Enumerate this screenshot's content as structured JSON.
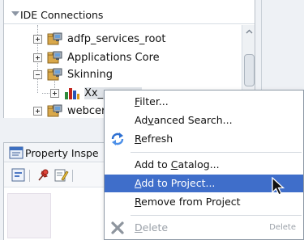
{
  "ide_connections": {
    "title": "IDE Connections",
    "tree": [
      {
        "label": "adfp_services_root",
        "expanded": false,
        "icon": "folder-connection-icon"
      },
      {
        "label": "Applications Core",
        "expanded": false,
        "icon": "folder-connection-icon"
      },
      {
        "label": "Skinning",
        "expanded": true,
        "icon": "folder-connection-icon"
      },
      {
        "label": "Xx_",
        "expanded": false,
        "icon": "chart-object-icon"
      },
      {
        "label": "webcer",
        "expanded": false,
        "icon": "folder-connection-icon"
      }
    ]
  },
  "property_inspector": {
    "title": "Property Inspe",
    "icon": "property-inspector-icon"
  },
  "context_menu": {
    "items": [
      {
        "pre": "",
        "mnemonic": "F",
        "post": "ilter...",
        "icon": "",
        "shortcut": "",
        "state": "normal"
      },
      {
        "pre": "Ad",
        "mnemonic": "v",
        "post": "anced Search...",
        "icon": "",
        "shortcut": "",
        "state": "normal"
      },
      {
        "pre": "",
        "mnemonic": "R",
        "post": "efresh",
        "icon": "refresh-icon",
        "shortcut": "",
        "state": "normal"
      },
      {
        "pre": "Add to ",
        "mnemonic": "C",
        "post": "atalog...",
        "icon": "",
        "shortcut": "",
        "state": "normal"
      },
      {
        "pre": "",
        "mnemonic": "A",
        "post": "dd to Project...",
        "icon": "",
        "shortcut": "",
        "state": "selected"
      },
      {
        "pre": "",
        "mnemonic": "R",
        "post": "emove from Project",
        "icon": "",
        "shortcut": "",
        "state": "normal"
      },
      {
        "pre": "",
        "mnemonic": "D",
        "post": "elete",
        "icon": "delete-icon",
        "shortcut": "Delete",
        "state": "disabled"
      }
    ]
  },
  "colors": {
    "selection": "#3f6eca",
    "menu_border": "#8f9aa7",
    "panel_bg": "#eef1f5",
    "disabled_text": "#9aa0a8"
  }
}
